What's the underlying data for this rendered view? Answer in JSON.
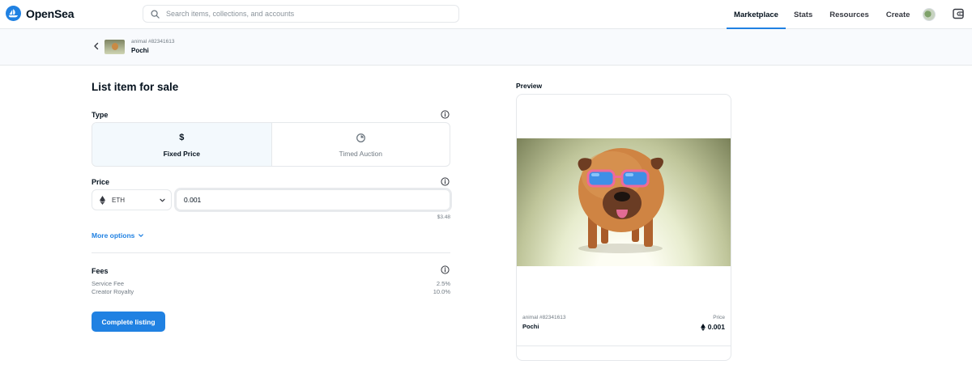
{
  "nav": {
    "brand": "OpenSea",
    "search_placeholder": "Search items, collections, and accounts",
    "links": [
      {
        "label": "Marketplace",
        "active": true
      },
      {
        "label": "Stats",
        "active": false
      },
      {
        "label": "Resources",
        "active": false
      },
      {
        "label": "Create",
        "active": false
      }
    ]
  },
  "subheader": {
    "collection": "animal #82341613",
    "item_name": "Pochi"
  },
  "form": {
    "title": "List item for sale",
    "type_label": "Type",
    "types": [
      {
        "label": "Fixed Price",
        "icon": "dollar-icon",
        "glyph": "$",
        "selected": true
      },
      {
        "label": "Timed Auction",
        "icon": "timer-icon",
        "selected": false
      }
    ],
    "price_label": "Price",
    "currency": "ETH",
    "price_value": "0.001",
    "usd_value": "$3.48",
    "more_options": "More options",
    "fees_label": "Fees",
    "fees": [
      {
        "label": "Service Fee",
        "value": "2.5%"
      },
      {
        "label": "Creator Royalty",
        "value": "10.0%"
      }
    ],
    "submit_label": "Complete listing"
  },
  "preview": {
    "title": "Preview",
    "collection": "animal #82341613",
    "name": "Pochi",
    "price_label": "Price",
    "price": "0.001"
  },
  "colors": {
    "accent": "#2081e2",
    "text": "#04111d",
    "muted": "#707a83",
    "border": "#e5e8eb"
  }
}
